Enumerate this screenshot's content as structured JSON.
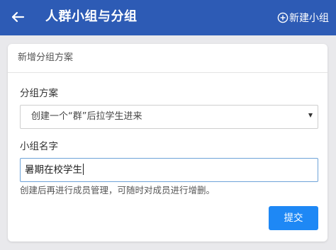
{
  "header": {
    "title": "人群小组与分组",
    "back_icon": "arrow-left-icon",
    "new_group_icon": "circle-plus-icon",
    "new_group_label": "新建小组",
    "background_color": "#2d5bb5"
  },
  "card": {
    "title": "新增分组方案",
    "scheme_label": "分组方案",
    "scheme_selected": "创建一个“群”后拉学生进来",
    "name_label": "小组名字",
    "name_value": "暑期在校学生",
    "hint": "创建后再进行成员管理，可随时对成员进行增删。",
    "submit_label": "提交",
    "submit_color": "#1e88f5"
  }
}
